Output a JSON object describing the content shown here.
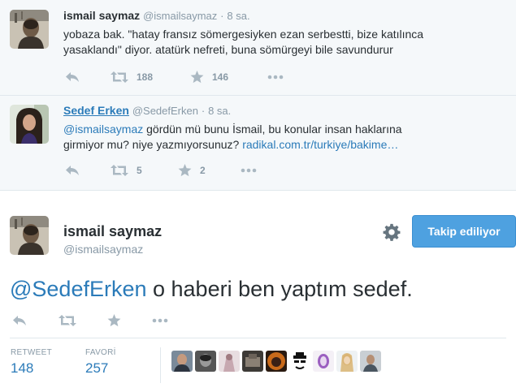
{
  "tweets": [
    {
      "name": "ismail saymaz",
      "handle": "@ismailsaymaz",
      "dot": "·",
      "time": "8 sa.",
      "text": "yobaza bak. \"hatay fransız sömergesiyken ezan serbestti, bize katılınca yasaklandı\" diyor. atatürk nefreti, buna sömürgeyi bile savundurur",
      "retweets": "188",
      "favorites": "146"
    },
    {
      "name": "Sedef Erken",
      "handle": "@SedefErken",
      "dot": "·",
      "time": "8 sa.",
      "mention": "@ismailsaymaz",
      "text": " gördün mü bunu İsmail, bu konular insan haklarına girmiyor mu? niye yazmıyorsunuz? ",
      "link": "radikal.com.tr/turkiye/bakime…",
      "retweets": "5",
      "favorites": "2"
    }
  ],
  "main": {
    "name": "ismail saymaz",
    "handle": "@ismailsaymaz",
    "follow_label": "Takip ediliyor",
    "mention": "@SedefErken",
    "text": " o haberi ben yaptım sedef.",
    "retweet_label": "RETWEET",
    "retweet_count": "148",
    "favorite_label": "FAVORİ",
    "favorite_count": "257"
  },
  "colors": {
    "link": "#2b7bb9",
    "button": "#4ea1e0",
    "muted": "#8899a6",
    "context_bg": "#f5f8fa"
  },
  "icons": [
    "reply-icon",
    "retweet-icon",
    "favorite-icon",
    "more-icon",
    "gear-icon"
  ]
}
